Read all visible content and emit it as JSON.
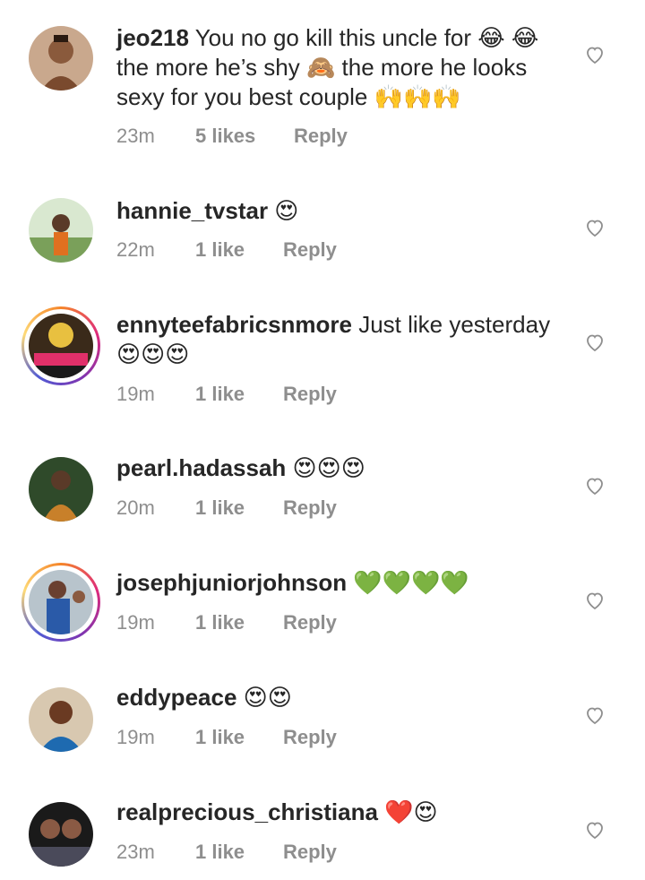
{
  "comments": [
    {
      "username": "jeo218",
      "text": " You no go kill this uncle for 😂 😂 the more he’s shy 🙈 the more he looks sexy for you best couple 🙌🙌🙌",
      "time": "23m",
      "likes": "5 likes",
      "reply": "Reply",
      "story_ring": false
    },
    {
      "username": "hannie_tvstar",
      "text": " 😍",
      "time": "22m",
      "likes": "1 like",
      "reply": "Reply",
      "story_ring": false
    },
    {
      "username": "ennyteefabricsnmore",
      "text": " Just like yesterday😍😍😍",
      "time": "19m",
      "likes": "1 like",
      "reply": "Reply",
      "story_ring": true
    },
    {
      "username": "pearl.hadassah",
      "text": " 😍😍😍",
      "time": "20m",
      "likes": "1 like",
      "reply": "Reply",
      "story_ring": false
    },
    {
      "username": "josephjuniorjohnson",
      "text": " 💚💚💚💚",
      "time": "19m",
      "likes": "1 like",
      "reply": "Reply",
      "story_ring": true
    },
    {
      "username": "eddypeace",
      "text": " 😍😍",
      "time": "19m",
      "likes": "1 like",
      "reply": "Reply",
      "story_ring": false
    },
    {
      "username": "realprecious_christiana",
      "text": " ❤️😍",
      "time": "23m",
      "likes": "1 like",
      "reply": "Reply",
      "story_ring": false
    }
  ],
  "colors": {
    "text_primary": "#262626",
    "text_secondary": "#8e8e8e",
    "heart_outline": "#8e8e8e"
  },
  "icons": {
    "like": "heart-outline-icon"
  }
}
